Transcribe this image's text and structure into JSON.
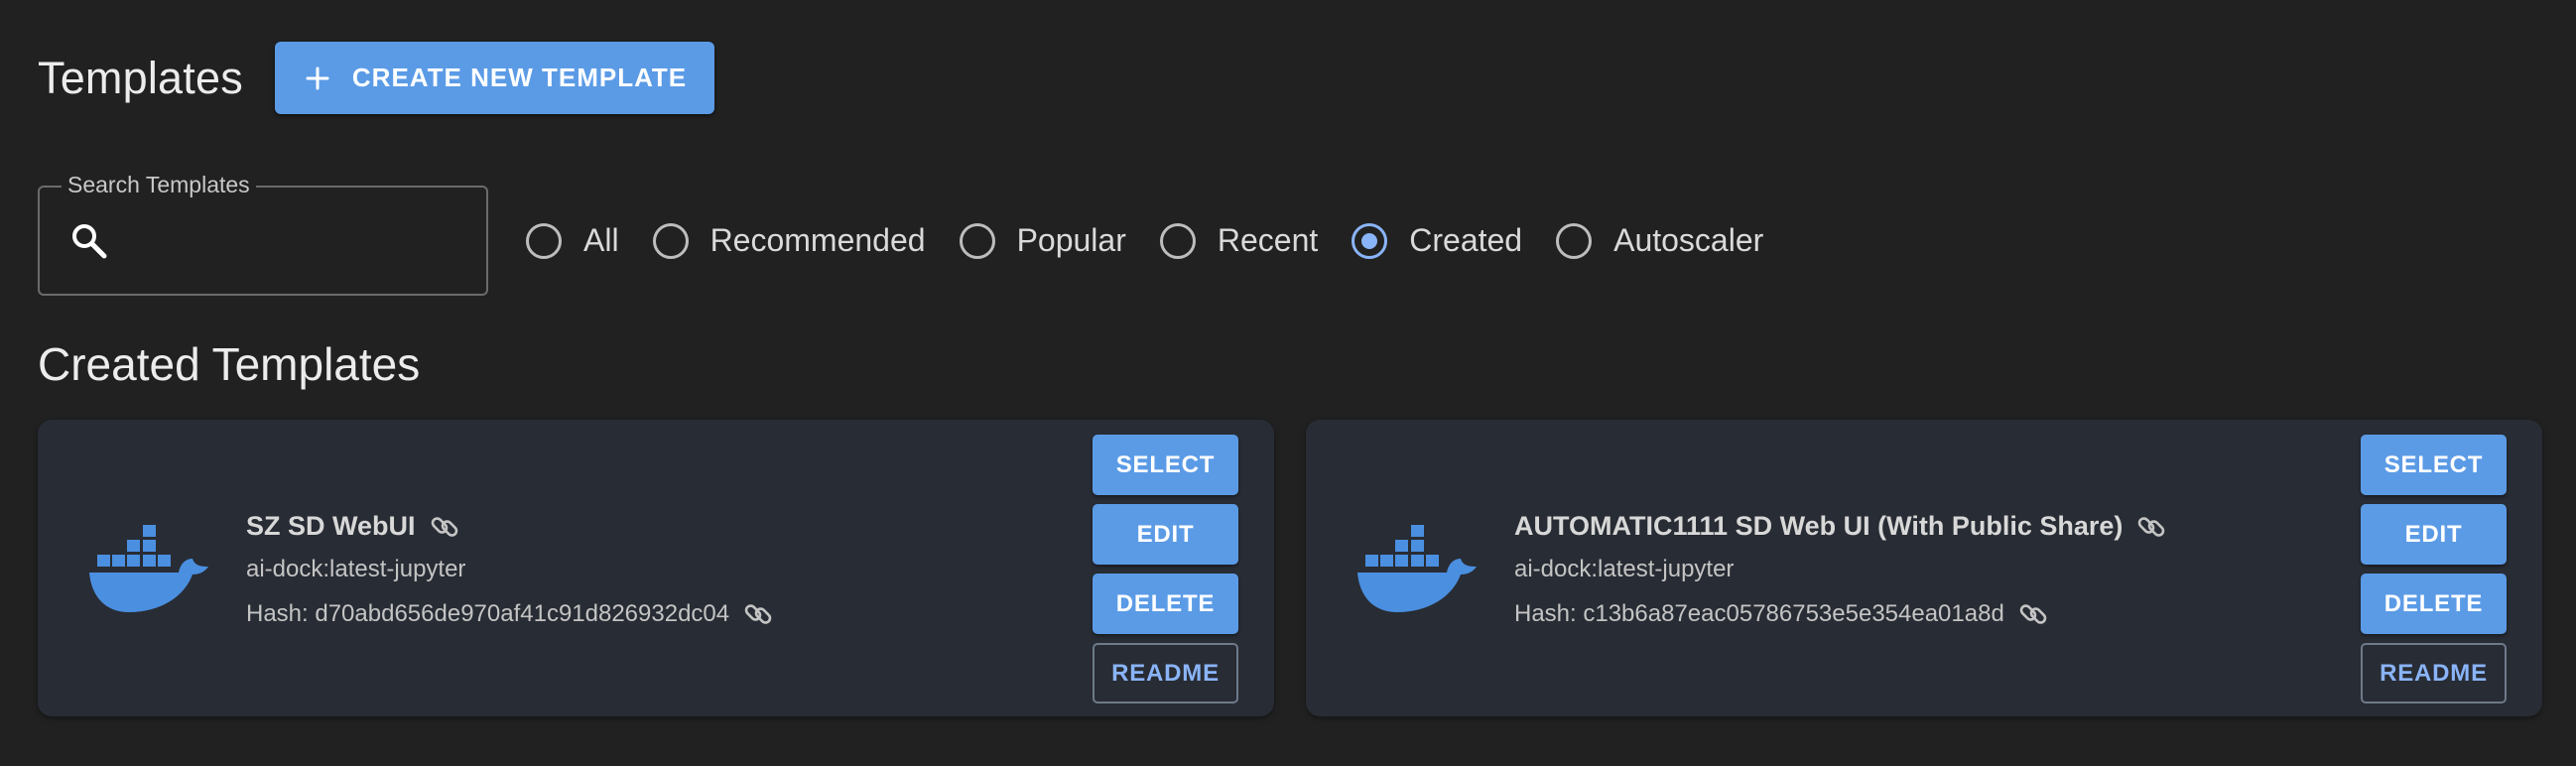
{
  "header": {
    "title": "Templates",
    "create_button": "CREATE NEW TEMPLATE"
  },
  "search": {
    "label": "Search Templates",
    "value": "",
    "placeholder": ""
  },
  "filters": {
    "options": [
      "All",
      "Recommended",
      "Popular",
      "Recent",
      "Created",
      "Autoscaler"
    ],
    "selected": "Created"
  },
  "section": {
    "title": "Created Templates"
  },
  "templates": [
    {
      "name": "SZ SD WebUI",
      "image": "ai-dock:latest-jupyter",
      "hash": "Hash: d70abd656de970af41c91d826932dc04",
      "buttons": {
        "select": "SELECT",
        "edit": "EDIT",
        "delete": "DELETE",
        "readme": "README"
      }
    },
    {
      "name": "AUTOMATIC1111 SD Web UI (With Public Share)",
      "image": "ai-dock:latest-jupyter",
      "hash": "Hash: c13b6a87eac05786753e5e354ea01a8d",
      "buttons": {
        "select": "SELECT",
        "edit": "EDIT",
        "delete": "DELETE",
        "readme": "README"
      }
    }
  ],
  "icons": {
    "plus": "plus-icon",
    "search": "search-icon",
    "docker": "docker-icon",
    "link": "link-icon"
  },
  "colors": {
    "background": "#212121",
    "card": "#282c34",
    "accent": "#5b9be6",
    "radio_selected": "#8ab4f8"
  }
}
